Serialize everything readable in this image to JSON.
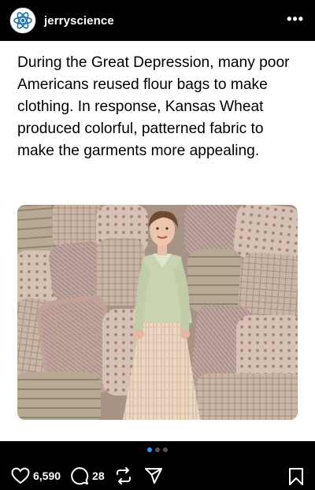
{
  "header": {
    "username": "jerryscience",
    "avatar_icon": "atom-icon",
    "more_label": "•••"
  },
  "post": {
    "caption": "During the Great Depression, many poor Americans reused flour bags to make clothing. In response, Kansas Wheat produced colorful, patterned fabric to make the garments more appealing.",
    "carousel": {
      "count": 3,
      "active_index": 0
    }
  },
  "actions": {
    "likes": "6,590",
    "comments": "28",
    "icons": [
      "heart-icon",
      "comment-icon",
      "repost-icon",
      "share-icon",
      "bookmark-icon"
    ]
  },
  "colors": {
    "background": "#000000",
    "card": "#ffffff",
    "accent": "#3797f0"
  }
}
